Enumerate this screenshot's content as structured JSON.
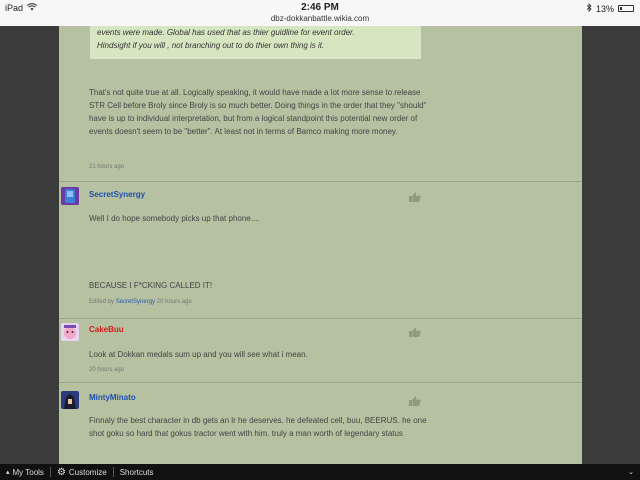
{
  "status": {
    "device": "iPad",
    "time": "2:46 PM",
    "url": "dbz-dokkanbattle.wikia.com",
    "battery": "13%"
  },
  "quote": {
    "lines": [
      "events were made. Global has used that as thier guidline for event order.",
      "Hindsight if you will , not branching out to do thier own thing is it."
    ]
  },
  "reply": {
    "text": "That's not quite true at all. Logically speaking, it would have made a lot more sense to release STR Cell before Broly since Broly is so much better. Doing things in the order that they \"should\" have is up to individual interpretation, but from a logical standpoint this potential new order of events doesn't seem to be \"better\". At least not in terms of Bamco making more money.",
    "time": "21 hours ago"
  },
  "comments": [
    {
      "user": "SecretSynergy",
      "user_color": "#1f4fb0",
      "line1": "Well I do hope somebody picks up that phone....",
      "line2": "BECAUSE I F*CKING CALLED IT!",
      "edited_prefix": "Edited by",
      "edited_by": "SecretSynergy",
      "time": "20 hours ago"
    },
    {
      "user": "CakeBuu",
      "user_color": "#d11c1c",
      "text": "Look at Dokkan medals sum up and you will see what i mean.",
      "time": "20 hours ago"
    },
    {
      "user": "MintyMinato",
      "user_color": "#1f4fb0",
      "text": "Finnaly the best character in db gets an lr he deserves. he defeated cell, buu, BEERUS. he one shot goku so hard that gokus tractor went with him. truly a man worth of legendary status"
    }
  ],
  "toolbar": {
    "my_tools": "My Tools",
    "customize": "Customize",
    "shortcuts": "Shortcuts"
  },
  "icons": [
    "wifi-icon",
    "bluetooth-icon",
    "battery-icon",
    "thumbs-up-icon",
    "gear-icon",
    "chevron-up-icon",
    "chevron-down-icon"
  ]
}
